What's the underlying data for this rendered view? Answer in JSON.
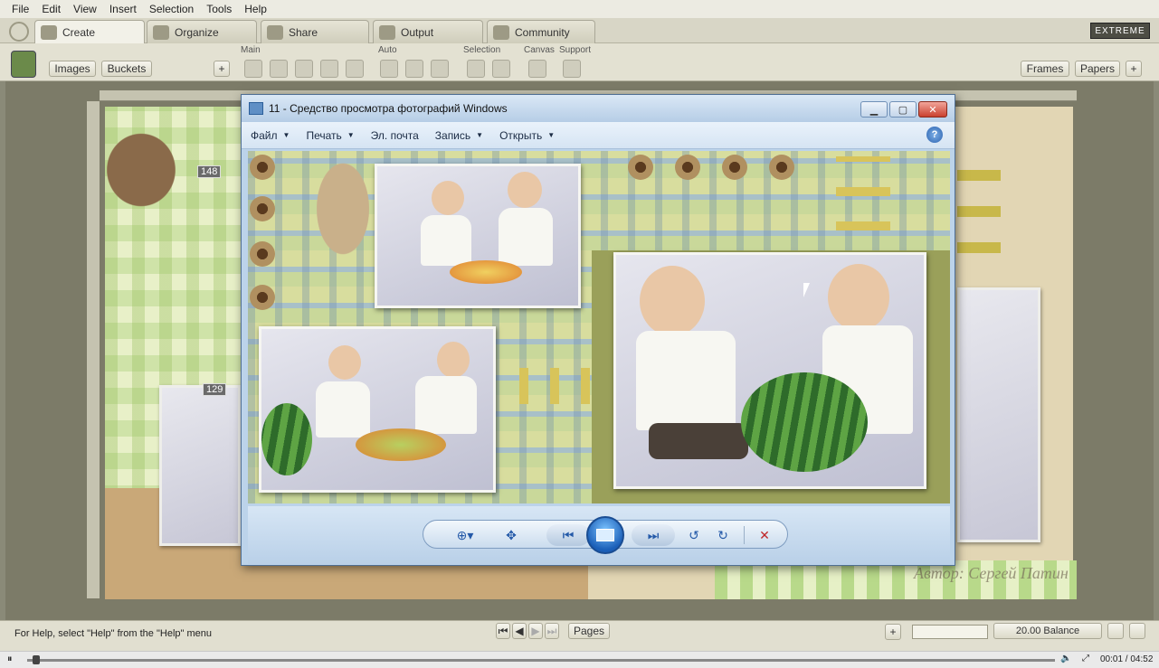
{
  "menu": [
    "File",
    "Edit",
    "View",
    "Insert",
    "Selection",
    "Tools",
    "Help"
  ],
  "tabs": [
    {
      "label": "Create",
      "icon": "create-icon"
    },
    {
      "label": "Organize",
      "icon": "organize-icon"
    },
    {
      "label": "Share",
      "icon": "share-icon"
    },
    {
      "label": "Output",
      "icon": "output-icon"
    },
    {
      "label": "Community",
      "icon": "community-icon"
    }
  ],
  "edition": "EXTREME",
  "toolbar": {
    "images_label": "Images",
    "buckets_label": "Buckets",
    "frames_label": "Frames",
    "papers_label": "Papers",
    "groups": [
      "Main",
      "Auto",
      "Selection",
      "Canvas",
      "Support"
    ]
  },
  "canvas": {
    "badge_a": "148",
    "badge_b": "129",
    "watermark": "Автор: Сергей Патин"
  },
  "viewer": {
    "title": "11 - Средство просмотра фотографий Windows",
    "menu": [
      "Файл",
      "Печать",
      "Эл. почта",
      "Запись",
      "Открыть"
    ],
    "help": "?"
  },
  "status": {
    "help_text": "For Help, select \"Help\" from the \"Help\" menu",
    "pages_label": "Pages",
    "balance": "20.00 Balance"
  },
  "video": {
    "time": "00:01 / 04:52"
  },
  "colors": {
    "accent": "#2459a8",
    "edition_bg": "#4d4d44"
  }
}
